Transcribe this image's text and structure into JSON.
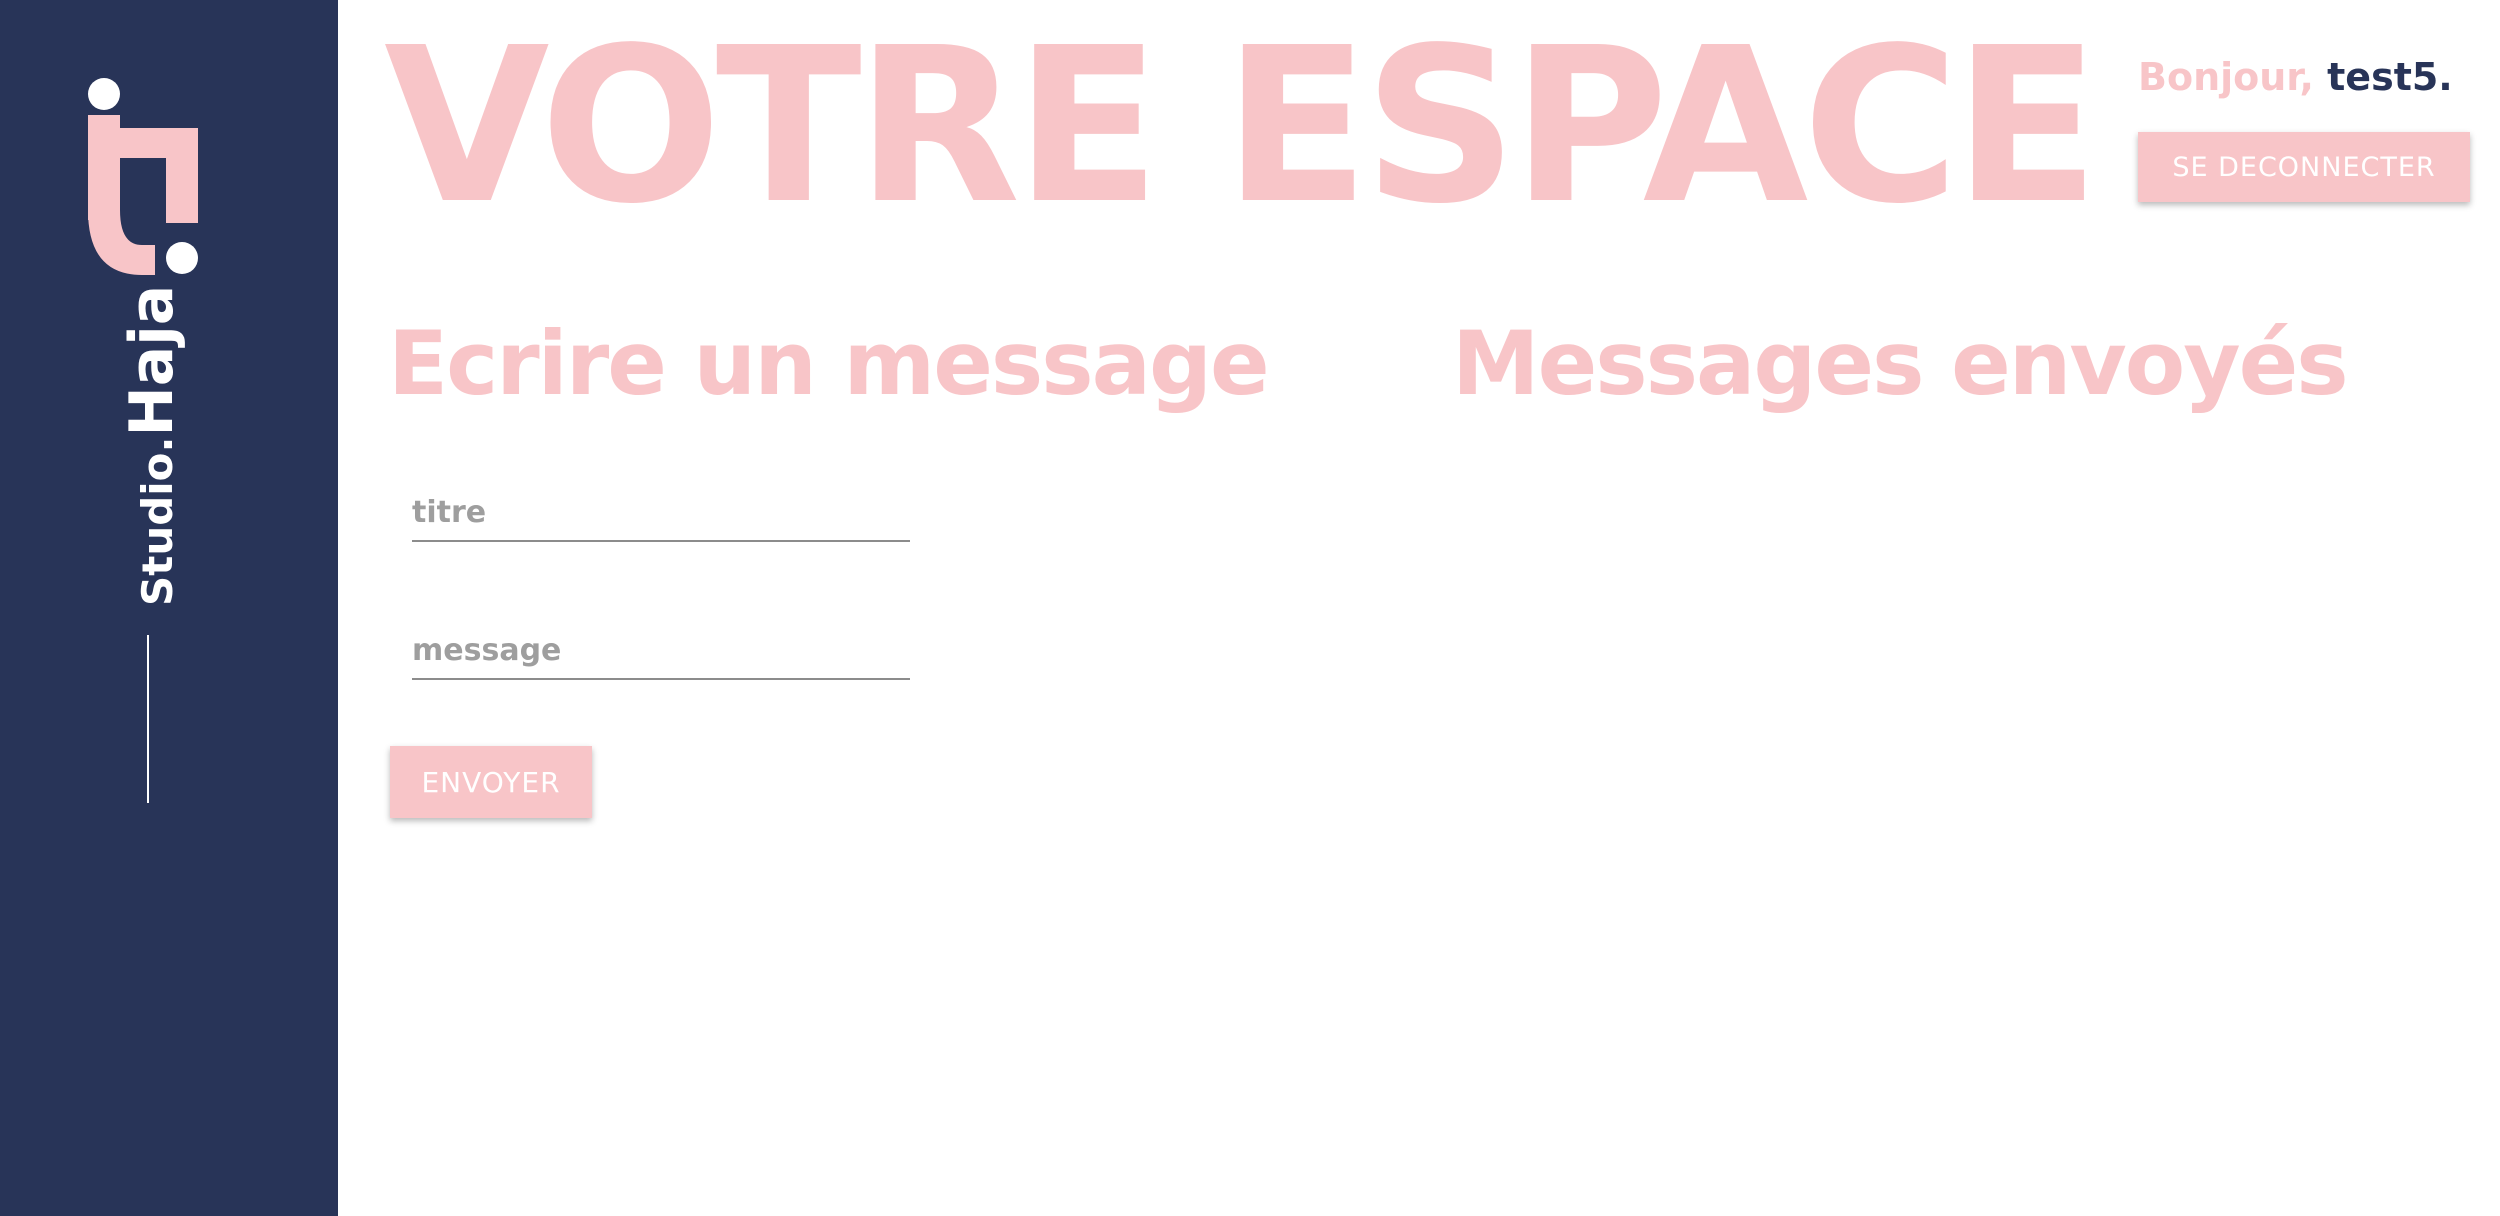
{
  "sidebar": {
    "brand_prefix": "Studio.",
    "brand_name": "Haja"
  },
  "header": {
    "title": "VOTRE ESPACE",
    "greeting": "Bonjour,",
    "username": "test5.",
    "logout_label": "SE DECONNECTER"
  },
  "compose": {
    "heading": "Ecrire un message",
    "title_placeholder": "titre",
    "message_placeholder": "message",
    "send_label": "ENVOYER"
  },
  "sent": {
    "heading": "Messages envoyés",
    "items": []
  },
  "colors": {
    "sidebar": "#283458",
    "accent_pink": "#f8c5c8",
    "white": "#ffffff"
  }
}
